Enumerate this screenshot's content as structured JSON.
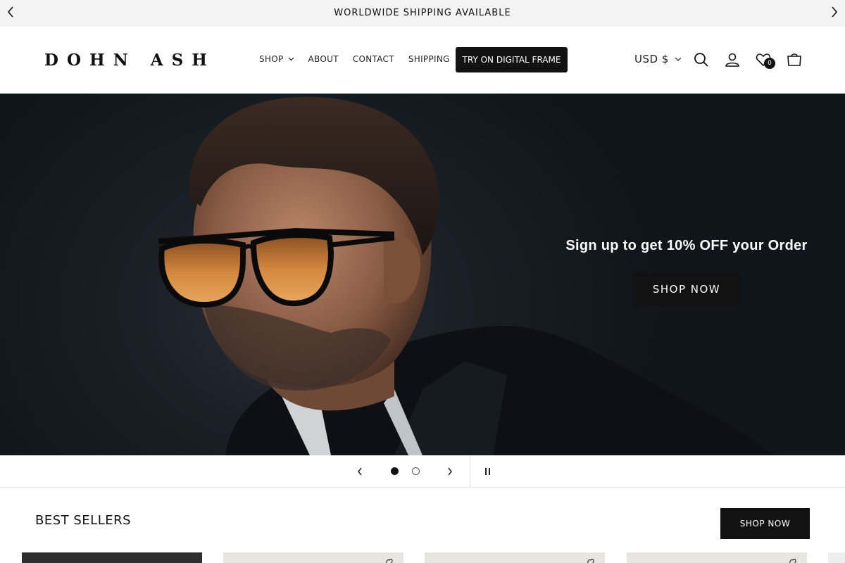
{
  "announcement": {
    "text": "WORLDWIDE SHIPPING AVAILABLE",
    "prev_icon": "chevron-left-icon",
    "next_icon": "chevron-right-icon"
  },
  "header": {
    "logo": "DOHN ASH",
    "nav": [
      {
        "label": "SHOP",
        "has_dropdown": true
      },
      {
        "label": "ABOUT"
      },
      {
        "label": "CONTACT"
      },
      {
        "label": "SHIPPING"
      }
    ],
    "cta_label": "TRY ON DIGITAL FRAME",
    "currency": "USD $",
    "icons": [
      "search-icon",
      "account-icon",
      "wishlist-icon",
      "cart-icon"
    ],
    "wishlist_count": "0"
  },
  "hero": {
    "headline": "Sign up to get 10% OFF your Order",
    "button_label": "SHOP NOW"
  },
  "slider": {
    "slides_total": 2,
    "active_slide": 1,
    "icons": [
      "chevron-left-icon",
      "chevron-right-icon",
      "pause-icon"
    ]
  },
  "best_sellers": {
    "title": "BEST SELLERS",
    "button_label": "SHOP NOW"
  },
  "colors": {
    "primary": "#121212",
    "announcement_bg": "#f3f3f3",
    "hero_bg": "#151a20",
    "lens": "#d4873e"
  }
}
